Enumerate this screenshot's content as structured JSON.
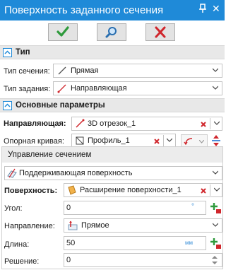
{
  "window": {
    "title": "Поверхность заданного сечения",
    "pin_glyph": "ᵻ",
    "close_glyph": "✕"
  },
  "actions": {
    "ok_icon": "check-icon",
    "preview_icon": "magnifier-icon",
    "cancel_icon": "cross-icon"
  },
  "section_type": {
    "header": "Тип",
    "section_kind_label": "Тип сечения:",
    "section_kind_value": "Прямая",
    "task_kind_label": "Тип задания:",
    "task_kind_value": "Направляющая"
  },
  "section_main": {
    "header": "Основные параметры",
    "guide_label": "Направляющая:",
    "guide_value": "3D отрезок_1",
    "ref_curve_label": "Опорная кривая:",
    "ref_curve_value": "Профиль_1"
  },
  "control": {
    "header": "Управление сечением",
    "mode_value": "Поддерживающая поверхность",
    "surfaces_label": "Поверхность:",
    "surfaces_value": "Расширение поверхности_1",
    "angle_label": "Угол:",
    "angle_value": "0",
    "angle_unit": "°",
    "direction_label": "Направление:",
    "direction_value": "Прямое",
    "length_label": "Длина:",
    "length_value": "50",
    "length_unit": "мм",
    "solution_label": "Решение:",
    "solution_value": "0"
  },
  "colors": {
    "titlebar": "#1f8ad8",
    "accent_red": "#d0262c",
    "accent_green": "#2e9a3c"
  }
}
